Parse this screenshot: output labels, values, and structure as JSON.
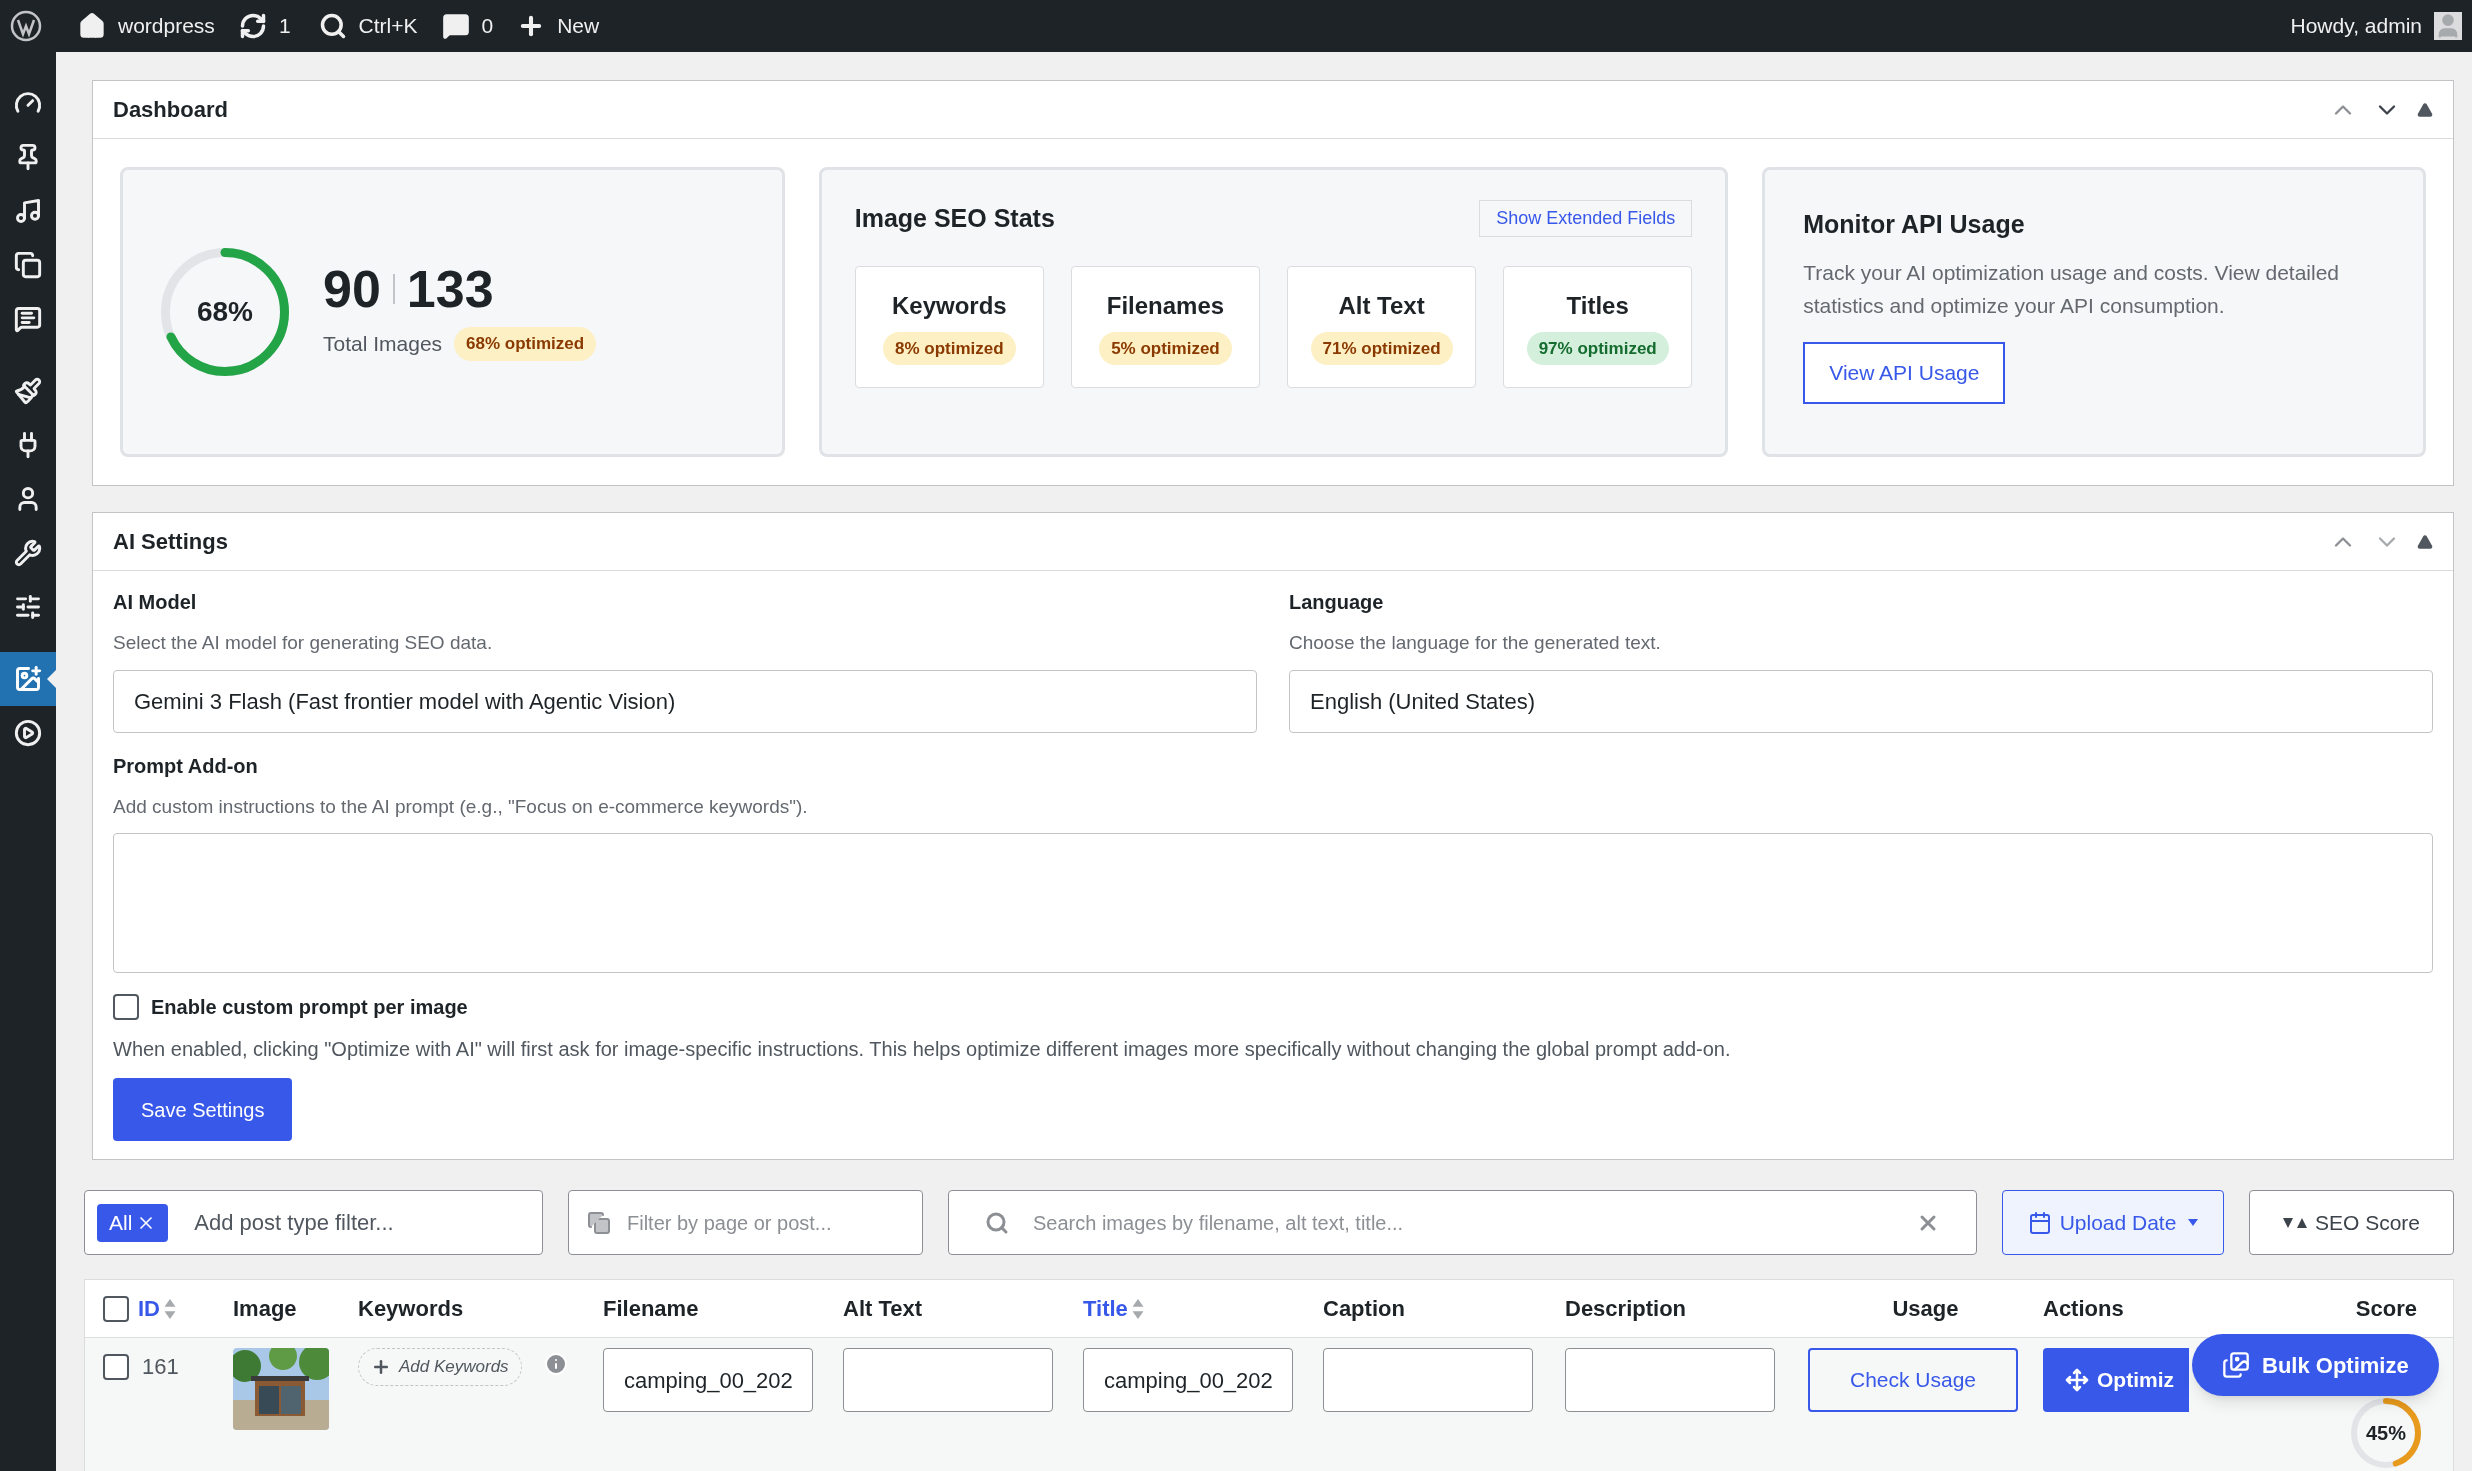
{
  "admin_bar": {
    "site": "wordpress",
    "updates": "1",
    "search": "Ctrl+K",
    "comments": "0",
    "new": "New",
    "greeting": "Howdy, admin"
  },
  "sidebar": {
    "items": [
      {
        "kind": "dashboard",
        "selected": false
      },
      {
        "kind": "pin",
        "selected": false
      },
      {
        "kind": "media",
        "selected": false
      },
      {
        "kind": "pages",
        "selected": false
      },
      {
        "kind": "comments",
        "selected": false
      },
      {
        "kind": "brush",
        "selected": false
      },
      {
        "kind": "plugin",
        "selected": false
      },
      {
        "kind": "user",
        "selected": false
      },
      {
        "kind": "wrench",
        "selected": false
      },
      {
        "kind": "settings",
        "selected": false
      },
      {
        "kind": "image-seo",
        "selected": true
      },
      {
        "kind": "play",
        "selected": false
      }
    ]
  },
  "dashboard": {
    "title": "Dashboard",
    "summary": {
      "percent": "68%",
      "level": 0.68,
      "optimized": "90",
      "total": "133",
      "label": "Total Images",
      "badge": "68% optimized",
      "color": "#fdf0c4"
    },
    "seo_stats": {
      "title": "Image SEO Stats",
      "button": "Show Extended Fields",
      "cards": [
        {
          "label": "Keywords",
          "badge": "8% optimized",
          "color": "#fdf0c4"
        },
        {
          "label": "Filenames",
          "badge": "5% optimized",
          "color": "#fdf0c4"
        },
        {
          "label": "Alt Text",
          "badge": "71% optimized",
          "color": "#fdf0c4"
        },
        {
          "label": "Titles",
          "badge": "97% optimized",
          "color": "#d4efdc"
        }
      ]
    },
    "api": {
      "title": "Monitor API Usage",
      "text": "Track your AI optimization usage and costs. View detailed statistics and optimize your API consumption.",
      "button": "View API Usage"
    }
  },
  "ai_settings": {
    "title": "AI Settings",
    "model": {
      "label": "AI Model",
      "hint": "Select the AI model for generating SEO data.",
      "value": "Gemini 3 Flash (Fast frontier model with Agentic Vision)"
    },
    "language": {
      "label": "Language",
      "hint": "Choose the language for the generated text.",
      "value": "English (United States)"
    },
    "prompt": {
      "label": "Prompt Add-on",
      "hint": "Add custom instructions to the AI prompt (e.g., \"Focus on e-commerce keywords\")."
    },
    "custom_prompt": {
      "label": "Enable custom prompt per image",
      "checked": false,
      "hint": "When enabled, clicking \"Optimize with AI\" will first ask for image-specific instructions. This helps optimize different images more specifically without changing the global prompt add-on."
    },
    "save": "Save Settings"
  },
  "filters": {
    "chip": "All",
    "post_type_placeholder": "Add post type filter...",
    "page_placeholder": "Filter by page or post...",
    "search_placeholder": "Search images by filename, alt text, title...",
    "upload_date": "Upload Date",
    "seo_score": "SEO Score"
  },
  "table": {
    "select_all_checked": false,
    "columns": [
      {
        "label": "ID",
        "sortable": true
      },
      {
        "label": "Image",
        "sortable": false
      },
      {
        "label": "Keywords",
        "sortable": false
      },
      {
        "label": "Filename",
        "sortable": false
      },
      {
        "label": "Alt Text",
        "sortable": false
      },
      {
        "label": "Title",
        "sortable": true
      },
      {
        "label": "Caption",
        "sortable": false
      },
      {
        "label": "Description",
        "sortable": false
      },
      {
        "label": "Usage",
        "sortable": false
      },
      {
        "label": "Actions",
        "sortable": false
      },
      {
        "label": "Score",
        "sortable": false
      }
    ],
    "rows": [
      {
        "checked": false,
        "id": "161",
        "keywords": "Add Keywords",
        "filename": "camping_00_202",
        "title": "camping_00_202",
        "usage": "Check Usage",
        "action": "Optimiz",
        "score": "45%",
        "level": 0.45
      }
    ]
  },
  "bulk_button": "Bulk Optimize"
}
